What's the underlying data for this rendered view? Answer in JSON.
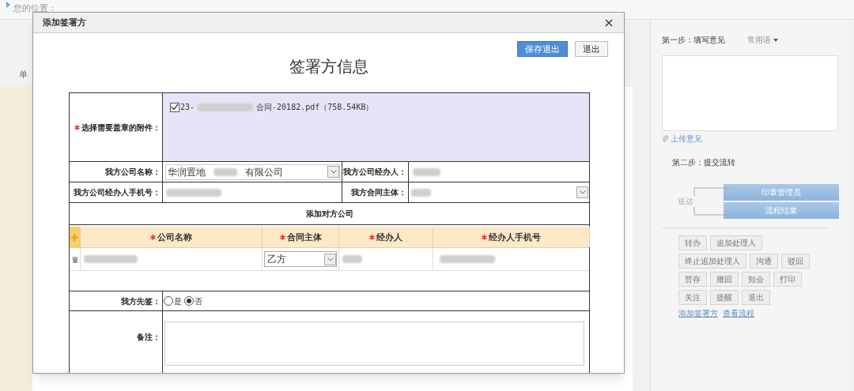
{
  "page": {
    "breadcrumb": "您的位置：",
    "side_label": "单"
  },
  "dialog": {
    "title": "添加签署方",
    "buttons": [
      {
        "label": "保存退出",
        "kind": "primary"
      },
      {
        "label": "退出",
        "kind": "default"
      }
    ],
    "heading": "签署方信息",
    "attachments": {
      "label": "选择需要盖章的附件：",
      "required": true,
      "files": [
        {
          "prefix": "23-",
          "name": "合同-20182.pdf（758.54KB）",
          "checked": true
        }
      ]
    },
    "company_name": {
      "label": "我方公司名称：",
      "prefix": "华润置地",
      "suffix": "有限公司"
    },
    "handler": {
      "label": "我方公司经办人："
    },
    "handler_phone": {
      "label": "我方公司经办人手机号："
    },
    "contract_party": {
      "label": "我方合同主体："
    },
    "counterparty": {
      "title": "添加对方公司",
      "columns": [
        {
          "label": "公司名称",
          "required": true
        },
        {
          "label": "合同主体",
          "required": true
        },
        {
          "label": "经办人",
          "required": true
        },
        {
          "label": "经办人手机号",
          "required": true
        }
      ],
      "rows": [
        {
          "contract_party": "乙方"
        }
      ]
    },
    "sign_first": {
      "label": "我方先签：",
      "options": [
        {
          "label": "是",
          "selected": false
        },
        {
          "label": "否",
          "selected": true
        }
      ]
    },
    "remarks": {
      "label": "备注："
    }
  },
  "side_panel": {
    "step1": "第一步：填写意见",
    "phrases": "常用语",
    "upload": "上传意见",
    "step2": "第二步：提交流转",
    "send_label": "送达",
    "targets": [
      "印章管理员",
      "流程结束"
    ],
    "action_rows": [
      [
        "转办",
        "追加处理人"
      ],
      [
        "终止追加处理人",
        "沟通",
        "驳回"
      ],
      [
        "暂存",
        "撤回",
        "知会",
        "打印"
      ],
      [
        "关注",
        "提醒",
        "退出"
      ]
    ],
    "links": [
      "添加签署方",
      "查看流程"
    ]
  }
}
